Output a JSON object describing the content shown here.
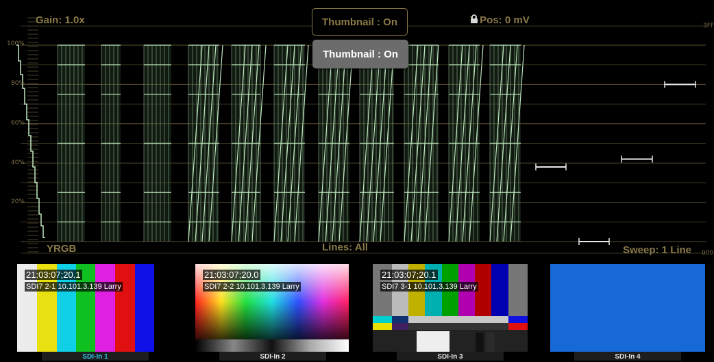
{
  "scope": {
    "gain": "Gain: 1.0x",
    "vpos": "V Pos: 0 mV",
    "colorspace": "YRGB",
    "lines": "Lines: All",
    "sweep": "Sweep: 1 Line",
    "lock_icon": "lock-icon",
    "right_top_label": "3FF",
    "right_bottom_label": "000",
    "graticule_labels": [
      "100%",
      "80%",
      "60%",
      "40%",
      "20%"
    ],
    "trace_color": "#bfe8bf"
  },
  "thumbnail_button": {
    "label": "Thumbnail : On"
  },
  "thumbnail_tooltip": {
    "label": "Thumbnail : On"
  },
  "inputs": [
    {
      "tab": "SDI-In 1",
      "timecode": "21:03:07;20.1",
      "source": "SDI7 2-1 10.101.3.139 Larry",
      "active": true
    },
    {
      "tab": "SDI-In 2",
      "timecode": "21:03:07;20.0",
      "source": "SDI7 2-2 10.101.3.139 Larry",
      "active": false
    },
    {
      "tab": "SDI-In 3",
      "timecode": "21:03:07;20.1",
      "source": "SDI7 3-1 10.101.3.139 Larry",
      "active": false
    },
    {
      "tab": "SDI-In 4",
      "timecode": "",
      "source": "",
      "active": false
    }
  ],
  "colors": {
    "accent_active": "#2fc4e6",
    "overlay_text": "#8a7a48",
    "input4_fill": "#1669d6"
  }
}
